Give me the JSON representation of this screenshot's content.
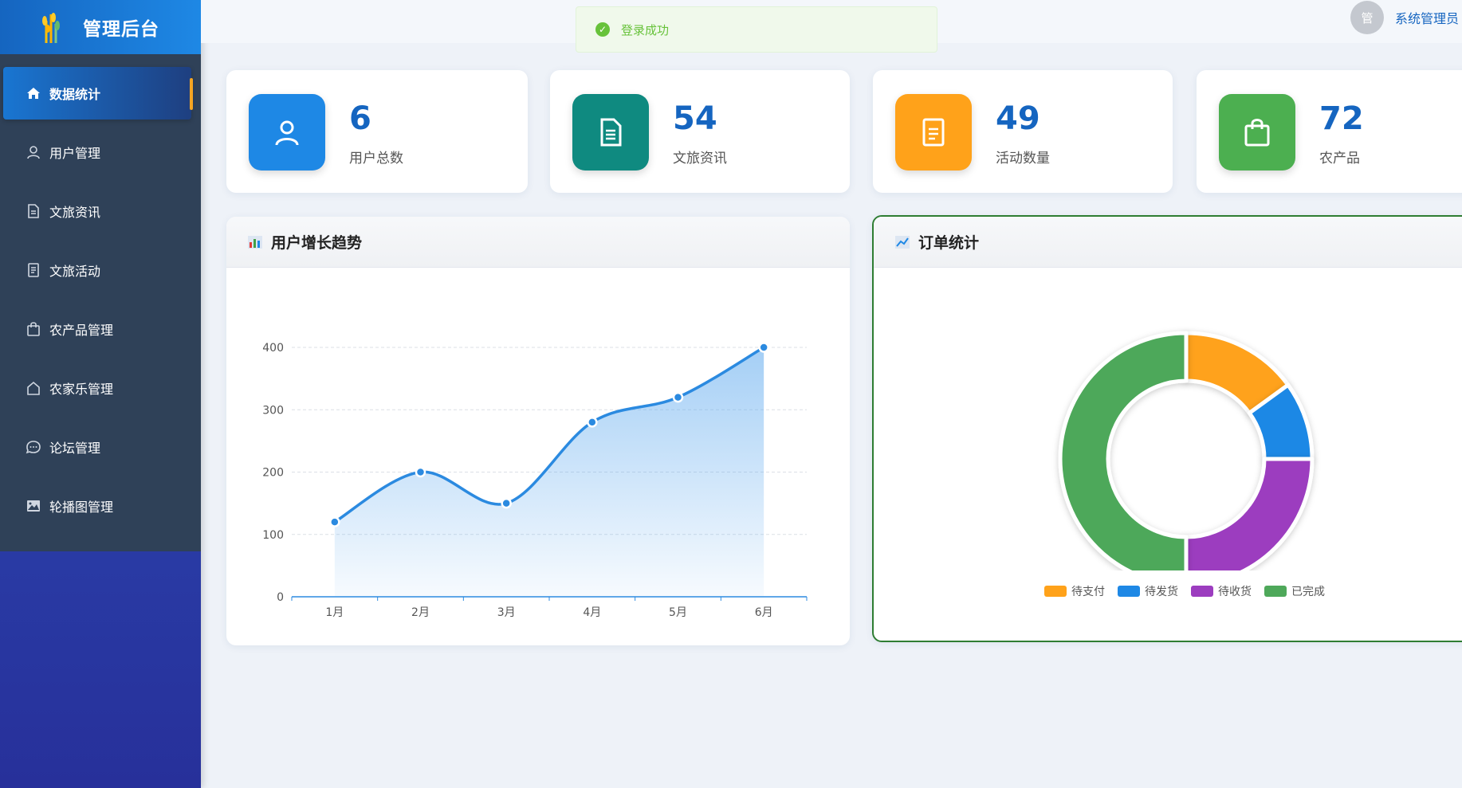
{
  "app": {
    "title": "管理后台"
  },
  "sidebar": {
    "items": [
      {
        "label": "数据统计",
        "icon": "home-icon",
        "active": true
      },
      {
        "label": "用户管理",
        "icon": "user-icon",
        "active": false
      },
      {
        "label": "文旅资讯",
        "icon": "document-icon",
        "active": false
      },
      {
        "label": "文旅活动",
        "icon": "list-icon",
        "active": false
      },
      {
        "label": "农产品管理",
        "icon": "shopping-bag-icon",
        "active": false
      },
      {
        "label": "农家乐管理",
        "icon": "house-icon",
        "active": false
      },
      {
        "label": "论坛管理",
        "icon": "chat-icon",
        "active": false
      },
      {
        "label": "轮播图管理",
        "icon": "image-icon",
        "active": false
      }
    ]
  },
  "header": {
    "toast": "登录成功",
    "avatar_text": "管",
    "user_name": "系统管理员"
  },
  "stats": [
    {
      "value": "6",
      "label": "用户总数",
      "icon": "user-icon",
      "color": "#1e88e5"
    },
    {
      "value": "54",
      "label": "文旅资讯",
      "icon": "document-icon",
      "color": "#0f8a80"
    },
    {
      "value": "49",
      "label": "活动数量",
      "icon": "list-icon",
      "color": "#ffa21a"
    },
    {
      "value": "72",
      "label": "农产品",
      "icon": "shopping-bag-icon",
      "color": "#4caf50"
    }
  ],
  "panels": {
    "user_growth_title": "用户增长趋势",
    "order_title": "订单统计"
  },
  "chart_data": [
    {
      "type": "area",
      "title": "用户增长趋势",
      "categories": [
        "1月",
        "2月",
        "3月",
        "4月",
        "5月",
        "6月"
      ],
      "values": [
        120,
        200,
        150,
        280,
        320,
        400
      ],
      "ylim": [
        0,
        400
      ],
      "yticks": [
        0,
        100,
        200,
        300,
        400
      ],
      "color": "#2b8ae0",
      "grid": true
    },
    {
      "type": "pie",
      "title": "订单统计",
      "donut": true,
      "labels": [
        "待支付",
        "待发货",
        "待收货",
        "已完成"
      ],
      "values": [
        15,
        10,
        25,
        50
      ],
      "colors": [
        "#ffa21a",
        "#1e88e5",
        "#9c3dbf",
        "#4ea85a"
      ],
      "legend": "bottom"
    }
  ]
}
